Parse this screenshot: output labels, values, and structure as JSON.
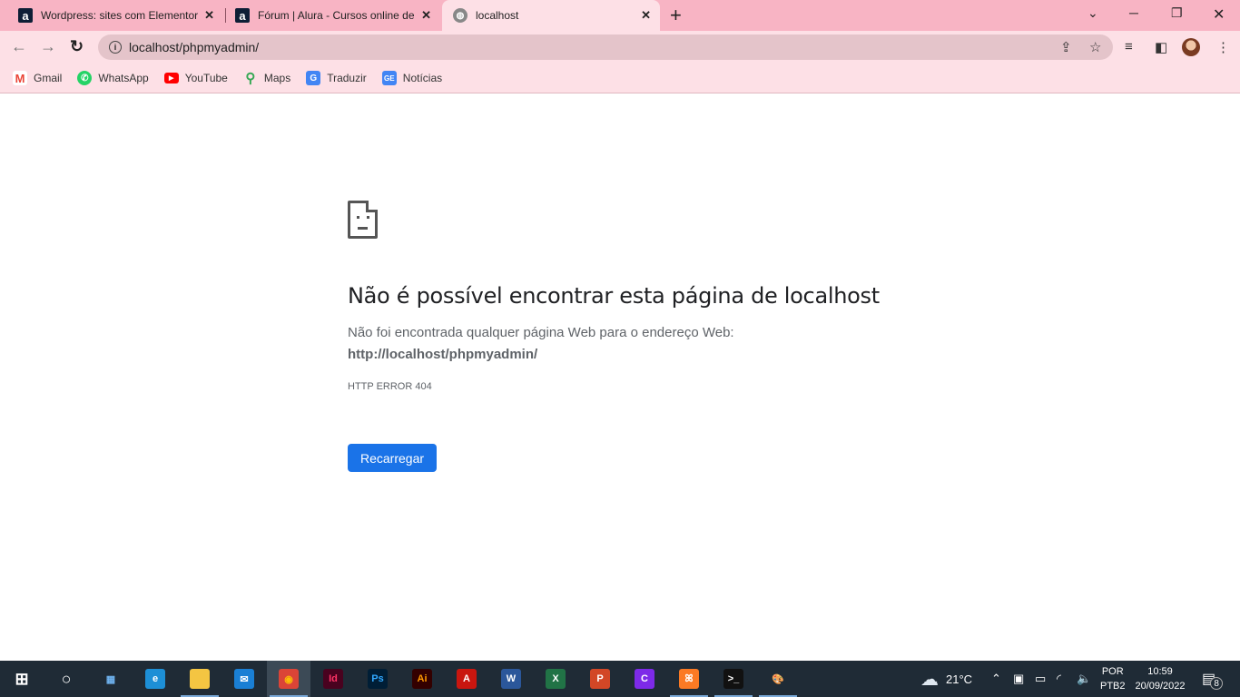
{
  "tabs": [
    {
      "title": "Wordpress: sites com Elementor",
      "favicon": "alura-icon"
    },
    {
      "title": "Fórum | Alura - Cursos online de",
      "favicon": "alura-icon"
    },
    {
      "title": "localhost",
      "favicon": "globe-icon",
      "active": true
    }
  ],
  "address": {
    "url": "localhost/phpmyadmin/"
  },
  "bookmarks": [
    {
      "label": "Gmail",
      "icon": "gmail-icon",
      "color": "#ea4335"
    },
    {
      "label": "WhatsApp",
      "icon": "whatsapp-icon",
      "color": "#25d366"
    },
    {
      "label": "YouTube",
      "icon": "youtube-icon",
      "color": "#ff0000"
    },
    {
      "label": "Maps",
      "icon": "maps-icon",
      "color": "#34a853"
    },
    {
      "label": "Traduzir",
      "icon": "translate-icon",
      "color": "#4285f4"
    },
    {
      "label": "Notícias",
      "icon": "news-icon",
      "color": "#4285f4"
    }
  ],
  "error": {
    "title": "Não é possível encontrar esta página de localhost",
    "description": "Não foi encontrada qualquer página Web para o endereço Web:",
    "url": "http://localhost/phpmyadmin/",
    "code": "HTTP ERROR 404",
    "reload_label": "Recarregar",
    "accent": "#1a73e8"
  },
  "taskbar": {
    "apps": [
      {
        "name": "start",
        "label": "⊞",
        "color": "#fff",
        "bg": "transparent"
      },
      {
        "name": "cortana",
        "label": "○",
        "color": "#fff",
        "bg": "transparent"
      },
      {
        "name": "control-panel",
        "label": "▦",
        "color": "#6fb3f0",
        "bg": "transparent"
      },
      {
        "name": "edge",
        "label": "e",
        "color": "#fff",
        "bg": "#1d8fd6"
      },
      {
        "name": "file-explorer",
        "label": "▬",
        "color": "#f4c542",
        "bg": "#f4c542",
        "run": true
      },
      {
        "name": "mail",
        "label": "✉",
        "color": "#fff",
        "bg": "#1a7fd4"
      },
      {
        "name": "chrome",
        "label": "◉",
        "color": "#fbbc05",
        "bg": "#db4437",
        "run": true,
        "active": true
      },
      {
        "name": "indesign",
        "label": "Id",
        "color": "#ff3366",
        "bg": "#49021f"
      },
      {
        "name": "photoshop",
        "label": "Ps",
        "color": "#31a8ff",
        "bg": "#001e36"
      },
      {
        "name": "illustrator",
        "label": "Ai",
        "color": "#ff9a00",
        "bg": "#330000"
      },
      {
        "name": "acrobat",
        "label": "A",
        "color": "#fff",
        "bg": "#c9160f"
      },
      {
        "name": "word",
        "label": "W",
        "color": "#fff",
        "bg": "#2b579a"
      },
      {
        "name": "excel",
        "label": "X",
        "color": "#fff",
        "bg": "#217346"
      },
      {
        "name": "powerpoint",
        "label": "P",
        "color": "#fff",
        "bg": "#d24726"
      },
      {
        "name": "canva",
        "label": "C",
        "color": "#fff",
        "bg": "#7d2ae8"
      },
      {
        "name": "xampp",
        "label": "ꕤ",
        "color": "#fff",
        "bg": "#fb7a24",
        "run": true
      },
      {
        "name": "terminal",
        "label": ">_",
        "color": "#fff",
        "bg": "#111",
        "run": true
      },
      {
        "name": "paint",
        "label": "🎨",
        "color": "#fff",
        "bg": "transparent",
        "run": true
      }
    ],
    "weather": "21°C",
    "language": "POR",
    "keyboard": "PTB2",
    "time": "10:59",
    "date": "20/09/2022",
    "notifications": "8"
  }
}
